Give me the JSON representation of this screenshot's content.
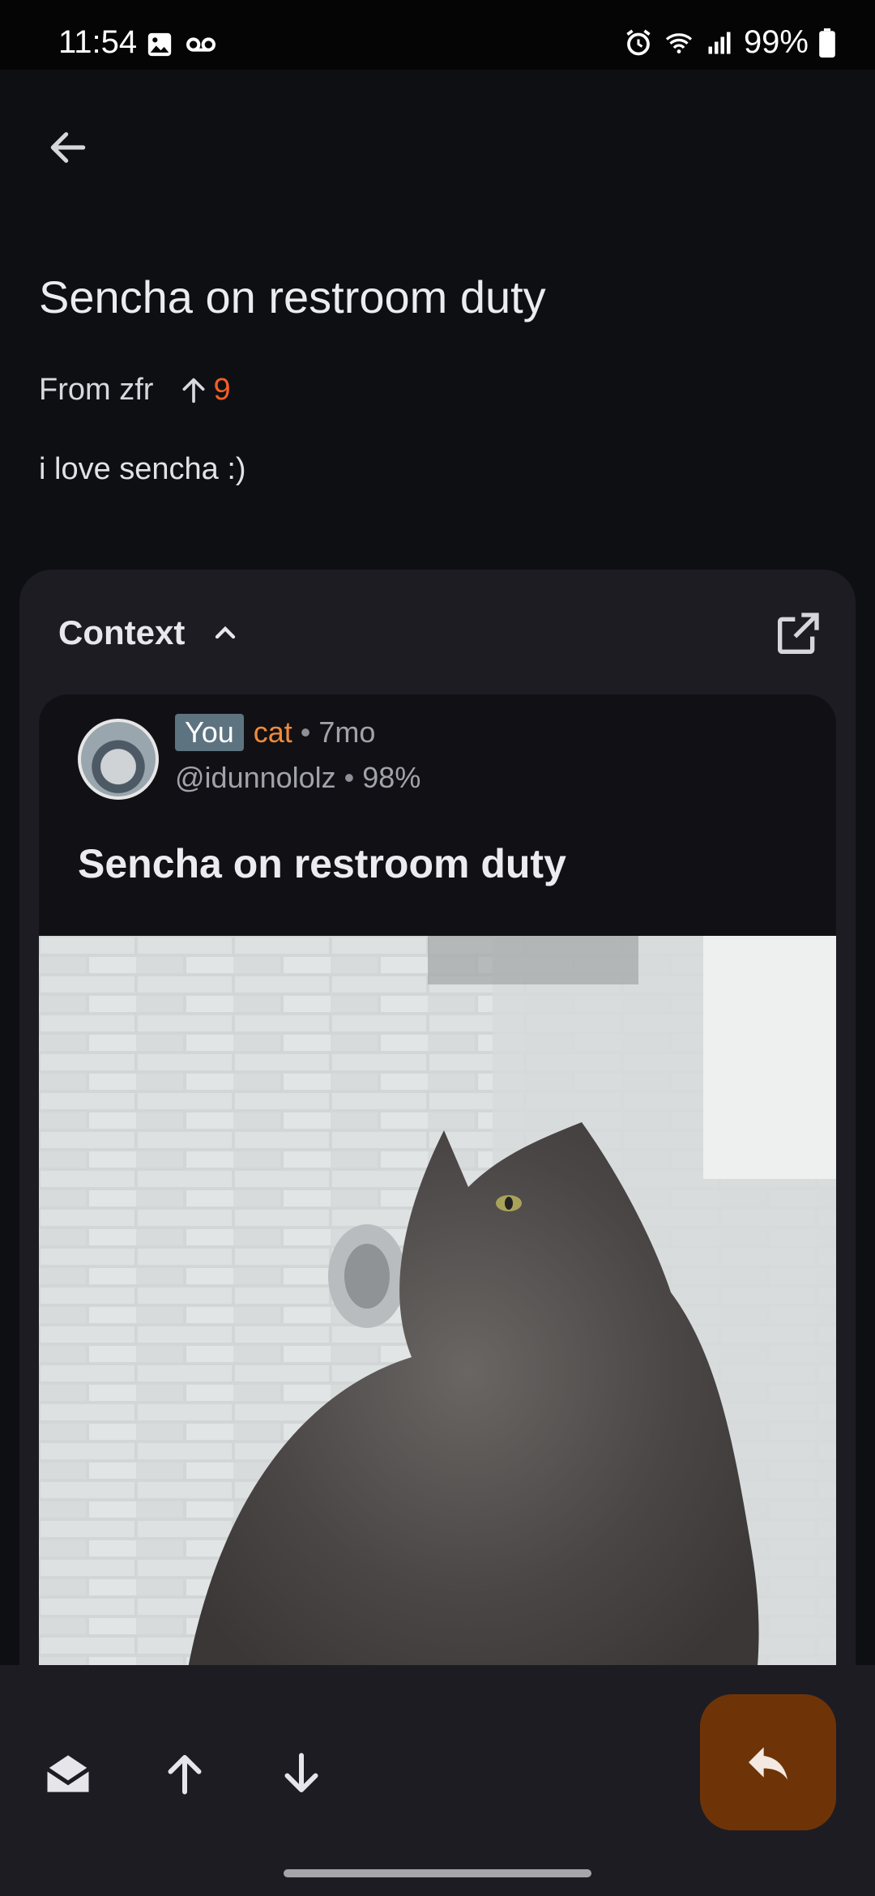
{
  "status_bar": {
    "time": "11:54",
    "battery": "99%",
    "icons": [
      "image-icon",
      "voicemail-icon",
      "alarm-icon",
      "wifi-icon",
      "signal-icon",
      "battery-icon"
    ]
  },
  "toolbar": {
    "back_icon": "arrow-back-icon"
  },
  "message": {
    "title": "Sencha on restroom duty",
    "from_label": "From zfr",
    "score": "9",
    "body": "i love sencha :)"
  },
  "context": {
    "header": "Context",
    "post": {
      "you_badge": "You",
      "community": "cat",
      "age": "7mo",
      "handle": "@idunnololz",
      "upvote_ratio": "98%",
      "title": "Sencha on restroom duty"
    }
  },
  "bottom_bar": {
    "icons": [
      "mark-read-icon",
      "upvote-icon",
      "downvote-icon",
      "reply-icon"
    ]
  },
  "colors": {
    "background": "#0e0f13",
    "card": "#1d1c23",
    "accent_score": "#f25f23",
    "community": "#f08a3a",
    "fab": "#6e3407"
  }
}
